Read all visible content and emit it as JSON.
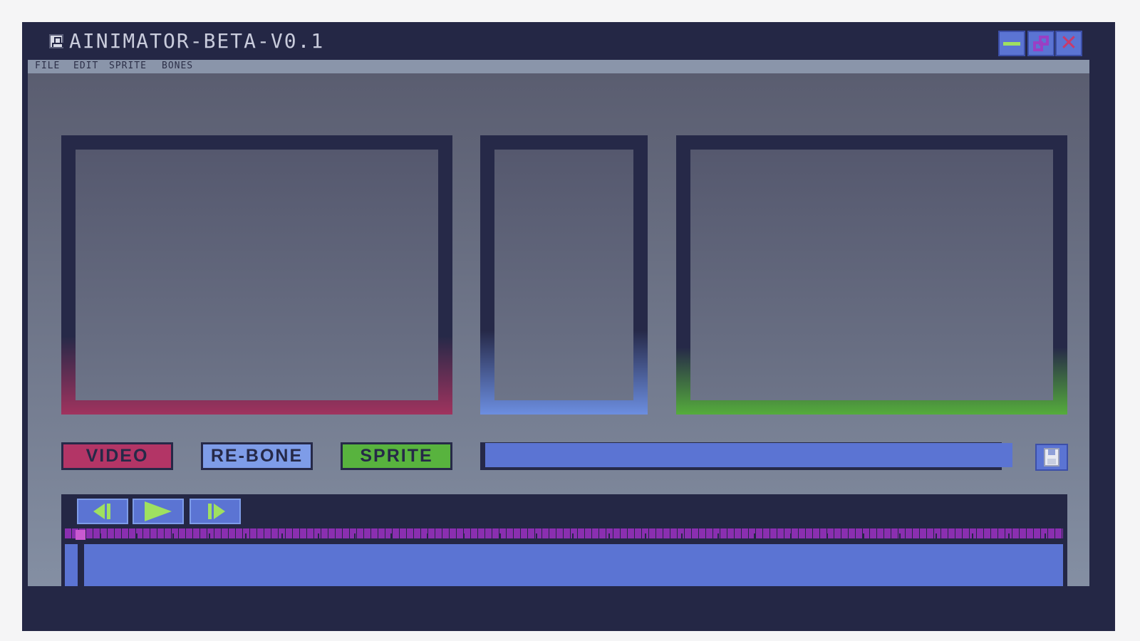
{
  "window": {
    "title": "AINIMATOR-BETA-V0.1",
    "app_icon": "skull-icon",
    "controls": {
      "minimize": "minimize-icon",
      "maximize": "maximize-icon",
      "close": "close-icon",
      "close_glyph": "✕"
    }
  },
  "menu": [
    "FILE",
    "EDIT",
    "SPRITE",
    "BONES"
  ],
  "panels": [
    {
      "name": "video-preview",
      "accent": "#a0335e"
    },
    {
      "name": "rebone-preview",
      "accent": "#6c8ee0"
    },
    {
      "name": "sprite-preview",
      "accent": "#55ac3c"
    }
  ],
  "modes": {
    "video": "VIDEO",
    "rebone": "RE-BONE",
    "sprite": "SPRITE"
  },
  "prompt": {
    "value": "",
    "placeholder": ""
  },
  "save": {
    "icon": "floppy-disk-icon"
  },
  "timeline": {
    "controls": [
      "step-back-icon",
      "play-icon",
      "step-forward-icon"
    ],
    "playhead_frame": 0
  },
  "colors": {
    "background": "#242745",
    "accent_blue": "#5b74d3",
    "accent_green": "#9fe060",
    "accent_magenta": "#b33566",
    "accent_purple": "#8a2fb0"
  }
}
